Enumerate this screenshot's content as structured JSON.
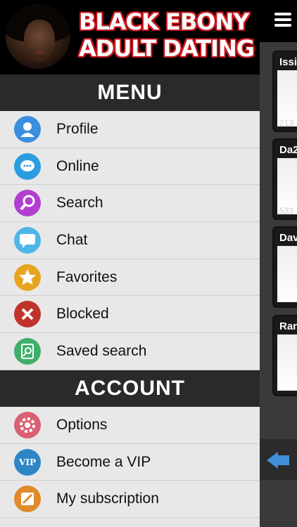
{
  "header": {
    "logo_line1": "BLACK EBONY",
    "logo_line2": "ADULT DATING",
    "menu_icon": "hamburger-icon"
  },
  "menu": {
    "title": "MENU",
    "items": [
      {
        "label": "Profile",
        "icon": "user-icon",
        "color": "#3a8fe0"
      },
      {
        "label": "Online",
        "icon": "chat-bubble-icon",
        "color": "#2a9de0"
      },
      {
        "label": "Search",
        "icon": "magnifier-icon",
        "color": "#b13fd0"
      },
      {
        "label": "Chat",
        "icon": "speech-bubble-icon",
        "color": "#4db6e8"
      },
      {
        "label": "Favorites",
        "icon": "star-icon",
        "color": "#e7a51f"
      },
      {
        "label": "Blocked",
        "icon": "x-circle-icon",
        "color": "#c0332b"
      },
      {
        "label": "Saved search",
        "icon": "saved-search-icon",
        "color": "#3fae6a"
      }
    ]
  },
  "account": {
    "title": "ACCOUNT",
    "items": [
      {
        "label": "Options",
        "icon": "gear-icon",
        "color": "#d95f72"
      },
      {
        "label": "Become a VIP",
        "icon": "vip-icon",
        "color": "#2f86c6",
        "icon_text": "VIP"
      },
      {
        "label": "My subscription",
        "icon": "pencil-icon",
        "color": "#e08a2c"
      }
    ]
  },
  "right_panel": {
    "cards": [
      {
        "name": "Issi",
        "number": "213"
      },
      {
        "name": "Da2",
        "number": "533"
      },
      {
        "name": "Dav",
        "number": ""
      },
      {
        "name": "Ran",
        "number": ""
      }
    ]
  }
}
